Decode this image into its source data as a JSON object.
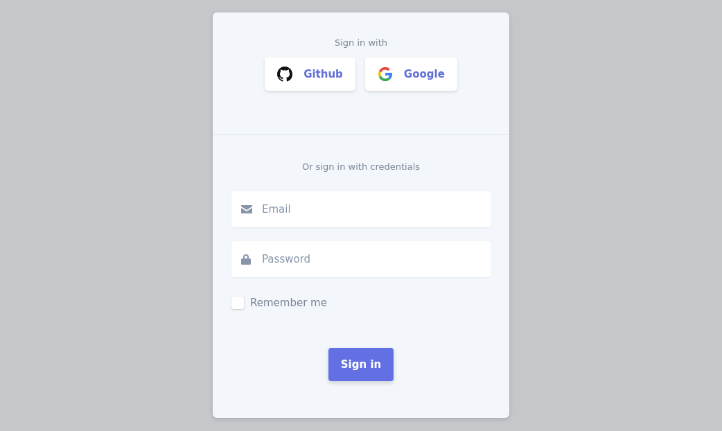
{
  "social": {
    "heading": "Sign in with",
    "buttons": [
      {
        "kind": "github",
        "label": "Github"
      },
      {
        "kind": "google",
        "label": "Google"
      }
    ]
  },
  "credentials": {
    "heading": "Or sign in with credentials",
    "fields": [
      {
        "kind": "email",
        "placeholder": "Email"
      },
      {
        "kind": "password",
        "placeholder": "Password"
      }
    ],
    "remember": {
      "label": "Remember me",
      "checked": false
    },
    "submit": "Sign in"
  }
}
